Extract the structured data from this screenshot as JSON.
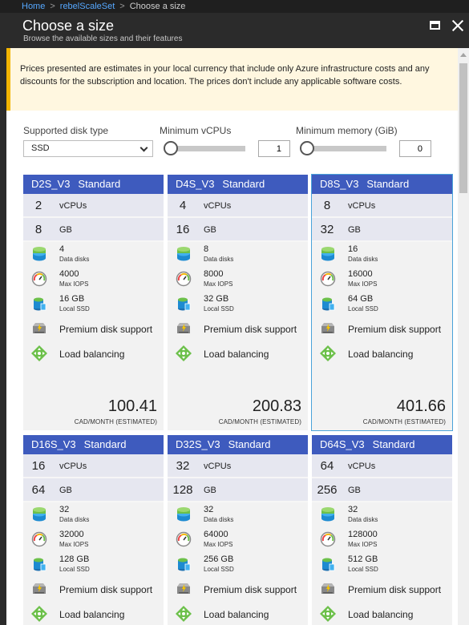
{
  "breadcrumb": {
    "home": "Home",
    "parent": "rebelScaleSet",
    "current": "Choose a size",
    "separator": ">"
  },
  "blade": {
    "title": "Choose a size",
    "subtitle": "Browse the available sizes and their features"
  },
  "banner": {
    "text": "Prices presented are estimates in your local currency that include only Azure infrastructure costs and any discounts for the subscription and location. The prices don't include any applicable software costs."
  },
  "filters": {
    "disk_type": {
      "label": "Supported disk type",
      "value": "SSD"
    },
    "min_vcpus": {
      "label": "Minimum vCPUs",
      "value": "1",
      "slider_level": 0
    },
    "min_memory": {
      "label": "Minimum memory (GiB)",
      "value": "0",
      "slider_level": 0
    }
  },
  "labels": {
    "vcpus": "vCPUs",
    "gb": "GB",
    "data_disks": "Data disks",
    "max_iops": "Max IOPS",
    "local_ssd": "Local SSD",
    "premium": "Premium disk support",
    "load_balancing": "Load balancing",
    "price_unit": "CAD/MONTH (ESTIMATED)"
  },
  "icons": {
    "disk": "data-disk-icon",
    "iops": "gauge-icon",
    "ssd": "ssd-icon",
    "premium": "premium-disk-icon",
    "lb": "load-balancing-icon"
  },
  "colors": {
    "card_header": "#3e5bbe",
    "selected_outline": "#4aa3d9",
    "banner_accent": "#f3b500"
  },
  "cards": [
    {
      "name": "D2S_V3",
      "tier": "Standard",
      "vcpus": "2",
      "gb": "8",
      "data_disks": "4",
      "max_iops": "4000",
      "local_ssd": "16 GB",
      "price": "100.41",
      "selected": false
    },
    {
      "name": "D4S_V3",
      "tier": "Standard",
      "vcpus": "4",
      "gb": "16",
      "data_disks": "8",
      "max_iops": "8000",
      "local_ssd": "32 GB",
      "price": "200.83",
      "selected": false
    },
    {
      "name": "D8S_V3",
      "tier": "Standard",
      "vcpus": "8",
      "gb": "32",
      "data_disks": "16",
      "max_iops": "16000",
      "local_ssd": "64 GB",
      "price": "401.66",
      "selected": true
    },
    {
      "name": "D16S_V3",
      "tier": "Standard",
      "vcpus": "16",
      "gb": "64",
      "data_disks": "32",
      "max_iops": "32000",
      "local_ssd": "128 GB",
      "price": "",
      "selected": false
    },
    {
      "name": "D32S_V3",
      "tier": "Standard",
      "vcpus": "32",
      "gb": "128",
      "data_disks": "32",
      "max_iops": "64000",
      "local_ssd": "256 GB",
      "price": "",
      "selected": false
    },
    {
      "name": "D64S_V3",
      "tier": "Standard",
      "vcpus": "64",
      "gb": "256",
      "data_disks": "32",
      "max_iops": "128000",
      "local_ssd": "512 GB",
      "price": "",
      "selected": false
    }
  ]
}
